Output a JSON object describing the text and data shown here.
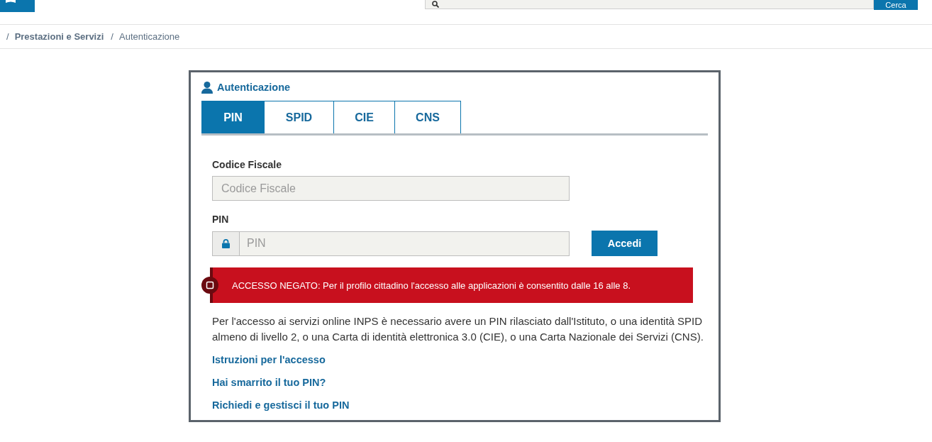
{
  "header": {
    "search_button": "Cerca"
  },
  "breadcrumb": {
    "separator": "/",
    "items": [
      {
        "label": "Prestazioni e Servizi",
        "current": false
      },
      {
        "label": "Autenticazione",
        "current": true
      }
    ]
  },
  "panel": {
    "title": "Autenticazione",
    "tabs": [
      {
        "label": "PIN",
        "selected": true
      },
      {
        "label": "SPID",
        "selected": false
      },
      {
        "label": "CIE",
        "selected": false
      },
      {
        "label": "CNS",
        "selected": false
      }
    ],
    "fields": [
      {
        "kind": "plain",
        "label": "Codice Fiscale",
        "placeholder": "Codice Fiscale"
      },
      {
        "kind": "locked",
        "label": "PIN",
        "placeholder": "PIN"
      }
    ],
    "submit": "Accedi",
    "alert": {
      "kind": "error",
      "message": "ACCESSO NEGATO: Per il profilo cittadino l'accesso alle applicazioni è consentito dalle 16 alle 8."
    },
    "description": "Per l'accesso ai servizi online INPS è necessario avere un PIN rilasciato dall'Istituto, o una identità SPID almeno di livello 2, o una Carta di identità elettronica 3.0 (CIE), o una Carta Nazionale dei Servizi (CNS).",
    "links": [
      "Istruzioni per l'accesso",
      "Hai smarrito il tuo PIN?",
      "Richiedi e gestisci il tuo PIN"
    ]
  }
}
